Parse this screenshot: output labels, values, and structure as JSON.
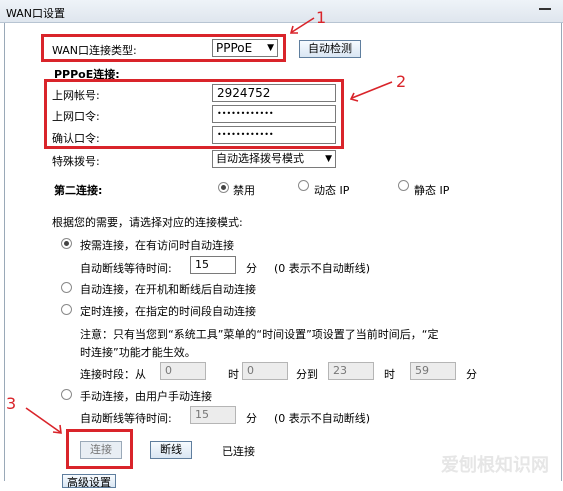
{
  "window": {
    "title": "WAN口设置"
  },
  "wan_type": {
    "label": "WAN口连接类型:",
    "value": "PPPoE",
    "detect_button": "自动检测"
  },
  "pppoe": {
    "section_title": "PPPoE连接:",
    "account_label": "上网帐号:",
    "account_value": "2924752",
    "password_label": "上网口令:",
    "password_value": "••••••••••••",
    "confirm_label": "确认口令:",
    "confirm_value": "••••••••••••"
  },
  "special_dial": {
    "label": "特殊拨号:",
    "value": "自动选择拨号模式"
  },
  "second_conn": {
    "label": "第二连接:",
    "options": [
      {
        "label": "禁用",
        "selected": true
      },
      {
        "label": "动态 IP",
        "selected": false
      },
      {
        "label": "静态 IP",
        "selected": false
      }
    ]
  },
  "mode": {
    "intro": "根据您的需要，请选择对应的连接模式:",
    "on_demand": {
      "label": "按需连接，在有访问时自动连接",
      "idle_label": "自动断线等待时间:",
      "idle_value": "15",
      "unit": "分",
      "hint": "(0 表示不自动断线)"
    },
    "auto": {
      "label": "自动连接，在开机和断线后自动连接"
    },
    "timed": {
      "label": "定时连接，在指定的时间段自动连接",
      "note_line1": "注意：只有当您到“系统工具”菜单的“时间设置”项设置了当前时间后，“定",
      "note_line2": "时连接”功能才能生效。",
      "period_label": "连接时段：从",
      "from_hour": "0",
      "hour_unit": "时",
      "from_min": "0",
      "to_label": "分到",
      "to_hour": "23",
      "hour_unit2": "时",
      "to_min": "59",
      "min_unit": "分"
    },
    "manual": {
      "label": "手动连接，由用户手动连接",
      "idle_label": "自动断线等待时间:",
      "idle_value": "15",
      "unit": "分",
      "hint": "(0 表示不自动断线)"
    }
  },
  "actions": {
    "connect": "连接",
    "disconnect": "断线",
    "status": "已连接",
    "advanced": "高级设置"
  },
  "annotations": {
    "n1": "1",
    "n2": "2",
    "n3": "3"
  },
  "watermark": "爱刨根知识网",
  "colors": {
    "annotation_red": "#d9242a",
    "title_bg": "#dfe6ee"
  }
}
